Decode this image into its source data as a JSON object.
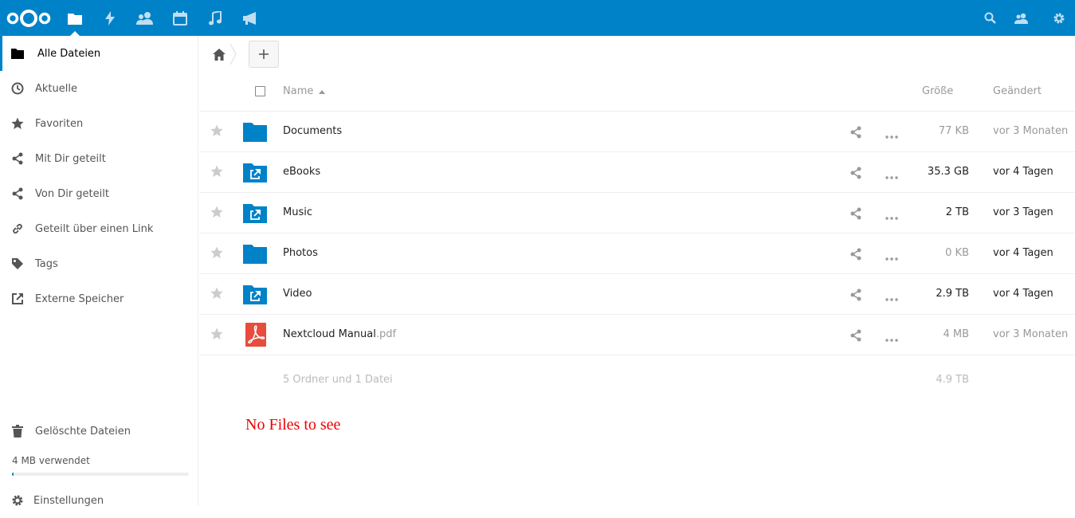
{
  "header": {
    "apps": [
      {
        "name": "logo",
        "icon": "nextcloud-logo"
      },
      {
        "name": "files",
        "icon": "folder-icon"
      },
      {
        "name": "activity",
        "icon": "lightning-icon"
      },
      {
        "name": "contacts",
        "icon": "contacts-icon"
      },
      {
        "name": "calendar",
        "icon": "calendar-icon"
      },
      {
        "name": "music",
        "icon": "music-icon"
      },
      {
        "name": "announcements",
        "icon": "megaphone-icon"
      }
    ],
    "right_icons": [
      "search-icon",
      "contacts-menu-icon",
      "settings-gear-icon"
    ],
    "background": "#0082c9"
  },
  "sidebar": {
    "items": [
      {
        "label": "Alle Dateien",
        "icon": "folder-icon"
      },
      {
        "label": "Aktuelle",
        "icon": "clock-icon"
      },
      {
        "label": "Favoriten",
        "icon": "star-icon"
      },
      {
        "label": "Mit Dir geteilt",
        "icon": "share-icon"
      },
      {
        "label": "Von Dir geteilt",
        "icon": "share-icon"
      },
      {
        "label": "Geteilt über einen Link",
        "icon": "link-icon"
      },
      {
        "label": "Tags",
        "icon": "tag-icon"
      },
      {
        "label": "Externe Speicher",
        "icon": "external-icon"
      }
    ],
    "trash_label": "Gelöschte Dateien",
    "quota_text": "4 MB verwendet",
    "quota_fraction": 0.01,
    "settings_label": "Einstellungen"
  },
  "table": {
    "columns": {
      "name": "Name",
      "size": "Größe",
      "modified": "Geändert"
    },
    "rows": [
      {
        "name": "Documents",
        "ext": "",
        "type": "folder",
        "size": "77 KB",
        "size_color": "#999",
        "modified": "vor 3 Monaten",
        "modified_color": "#999"
      },
      {
        "name": "eBooks",
        "ext": "",
        "type": "folder-external",
        "size": "35.3 GB",
        "size_color": "#222",
        "modified": "vor 4 Tagen",
        "modified_color": "#222"
      },
      {
        "name": "Music",
        "ext": "",
        "type": "folder-external",
        "size": "2 TB",
        "size_color": "#222",
        "modified": "vor 3 Tagen",
        "modified_color": "#222"
      },
      {
        "name": "Photos",
        "ext": "",
        "type": "folder",
        "size": "0 KB",
        "size_color": "#999",
        "modified": "vor 4 Tagen",
        "modified_color": "#222"
      },
      {
        "name": "Video",
        "ext": "",
        "type": "folder-external",
        "size": "2.9 TB",
        "size_color": "#222",
        "modified": "vor 4 Tagen",
        "modified_color": "#222"
      },
      {
        "name": "Nextcloud Manual",
        "ext": ".pdf",
        "type": "pdf",
        "size": "4 MB",
        "size_color": "#999",
        "modified": "vor 3 Monaten",
        "modified_color": "#999"
      }
    ],
    "summary": {
      "text": "5 Ordner und 1 Datei",
      "size": "4.9 TB"
    }
  },
  "empty_message": "No Files to see"
}
